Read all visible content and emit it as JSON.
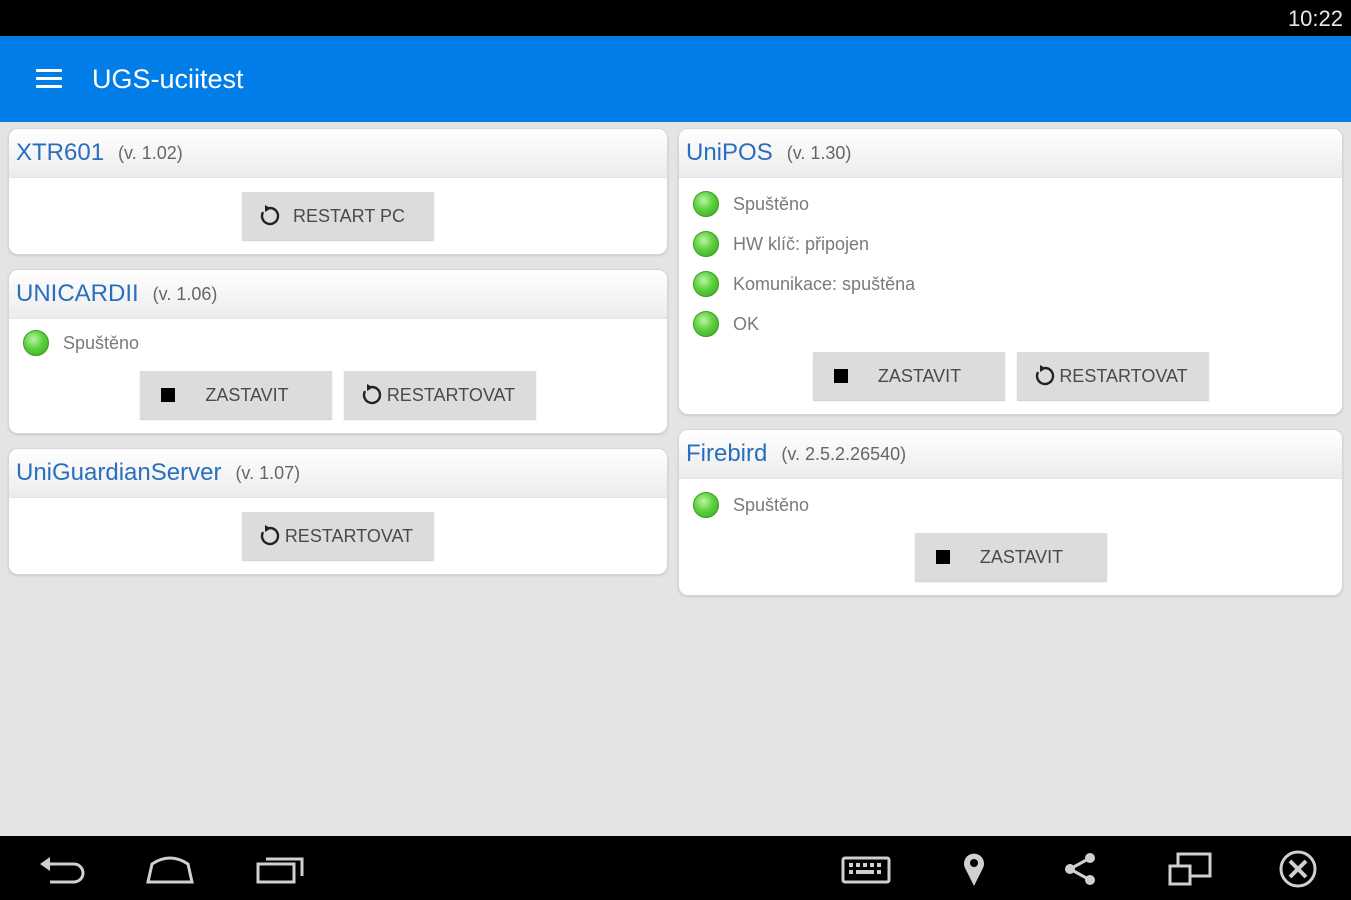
{
  "status_bar": {
    "time": "10:22"
  },
  "app_bar": {
    "title": "UGS-uciitest"
  },
  "cards": {
    "xtr601": {
      "name": "XTR601",
      "version": "(v. 1.02)",
      "buttons": {
        "restart_pc": "RESTART PC"
      }
    },
    "unicardii": {
      "name": "UNICARDII",
      "version": "(v. 1.06)",
      "statuses": [
        "Spuštěno"
      ],
      "buttons": {
        "stop": "ZASTAVIT",
        "restart": "RESTARTOVAT"
      }
    },
    "uniguardianserver": {
      "name": "UniGuardianServer",
      "version": "(v. 1.07)",
      "buttons": {
        "restart": "RESTARTOVAT"
      }
    },
    "unipos": {
      "name": "UniPOS",
      "version": "(v. 1.30)",
      "statuses": [
        "Spuštěno",
        "HW klíč: připojen",
        "Komunikace: spuštěna",
        "OK"
      ],
      "buttons": {
        "stop": "ZASTAVIT",
        "restart": "RESTARTOVAT"
      }
    },
    "firebird": {
      "name": "Firebird",
      "version": "(v. 2.5.2.26540)",
      "statuses": [
        "Spuštěno"
      ],
      "buttons": {
        "stop": "ZASTAVIT"
      }
    }
  },
  "colors": {
    "app_bar": "#007de6",
    "service_name": "#2a6fbf",
    "status_led": "#5ed13e",
    "background": "#e4e4e4"
  },
  "nav_bar": {
    "icons": [
      "back-icon",
      "home-icon",
      "recent-apps-icon",
      "keyboard-icon",
      "location-icon",
      "share-icon",
      "screen-rotate-icon",
      "close-icon"
    ]
  }
}
